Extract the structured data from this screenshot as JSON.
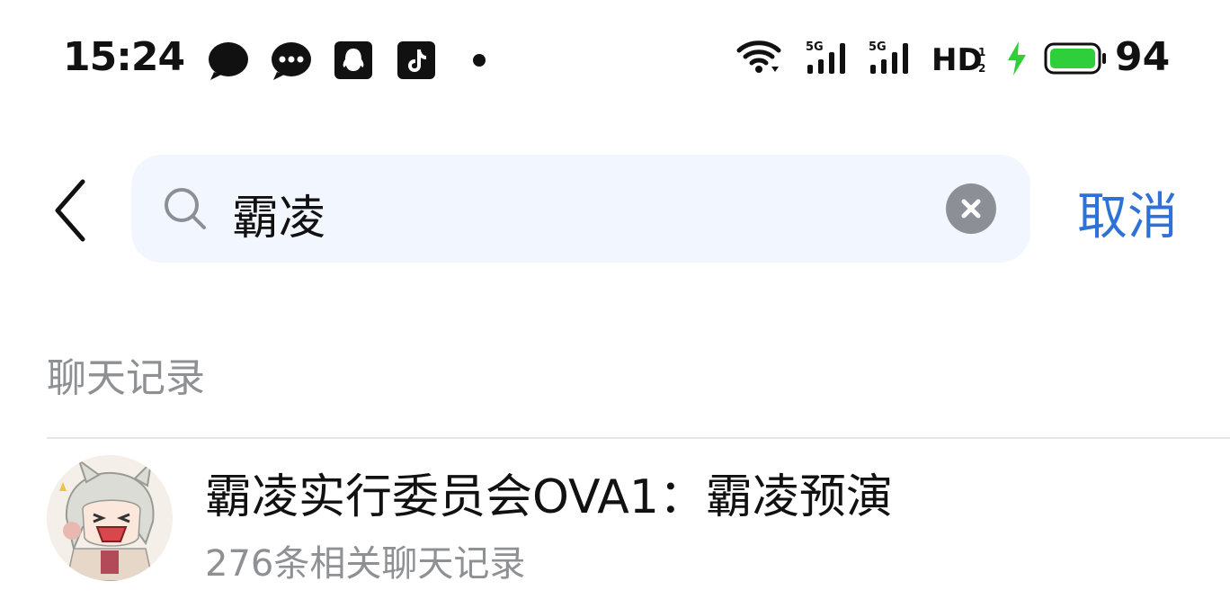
{
  "status_bar": {
    "time": "15:24",
    "network": "5G",
    "hd_label": "HD",
    "battery_percent": "94",
    "battery_color": "#2ecf3a"
  },
  "search": {
    "query": "霸凌",
    "cancel_label": "取消"
  },
  "section": {
    "title": "聊天记录"
  },
  "results": [
    {
      "title": "霸凌实行委员会OVA1：霸凌预演",
      "subtitle": "276条相关聊天记录"
    }
  ],
  "colors": {
    "accent": "#2f72d6",
    "search_bg": "#f2f6fe",
    "secondary_text": "#8f9094"
  }
}
